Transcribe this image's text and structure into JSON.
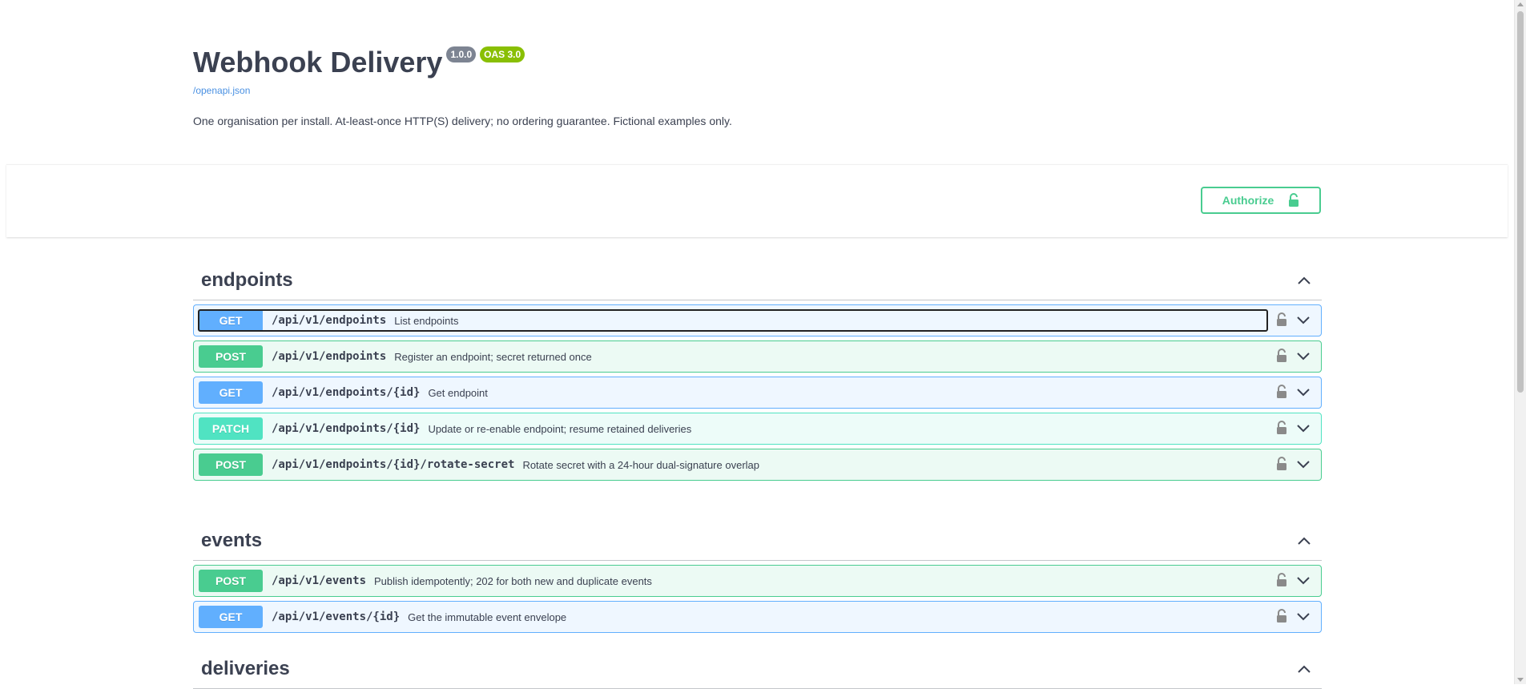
{
  "info": {
    "title": "Webhook Delivery",
    "version": "1.0.0",
    "oas": "OAS 3.0",
    "spec_link": "/openapi.json",
    "description": "One organisation per install. At-least-once HTTP(S) delivery; no ordering guarantee. Fictional examples only."
  },
  "authorize": {
    "label": "Authorize"
  },
  "tags": [
    {
      "name": "endpoints",
      "operations": [
        {
          "method": "GET",
          "path": "/api/v1/endpoints",
          "summary": "List endpoints"
        },
        {
          "method": "POST",
          "path": "/api/v1/endpoints",
          "summary": "Register an endpoint; secret returned once"
        },
        {
          "method": "GET",
          "path": "/api/v1/endpoints/{id}",
          "summary": "Get endpoint"
        },
        {
          "method": "PATCH",
          "path": "/api/v1/endpoints/{id}",
          "summary": "Update or re-enable endpoint; resume retained deliveries"
        },
        {
          "method": "POST",
          "path": "/api/v1/endpoints/{id}/rotate-secret",
          "summary": "Rotate secret with a 24-hour dual-signature overlap"
        }
      ]
    },
    {
      "name": "events",
      "operations": [
        {
          "method": "POST",
          "path": "/api/v1/events",
          "summary": "Publish idempotently; 202 for both new and duplicate events"
        },
        {
          "method": "GET",
          "path": "/api/v1/events/{id}",
          "summary": "Get the immutable event envelope"
        }
      ]
    },
    {
      "name": "deliveries",
      "operations": []
    }
  ],
  "colors": {
    "get": "#61affe",
    "post": "#49cc90",
    "patch": "#50e3c2",
    "text": "#3b4151",
    "link": "#4990e2"
  }
}
